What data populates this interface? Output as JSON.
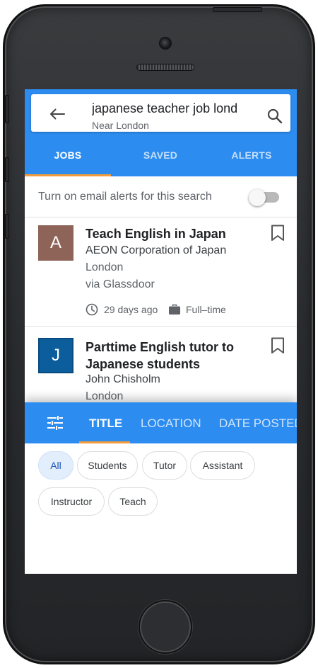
{
  "search": {
    "query": "japanese teacher job lond",
    "location": "Near London"
  },
  "tabs": {
    "jobs": "JOBS",
    "saved": "SAVED",
    "alerts": "ALERTS"
  },
  "alert_row": {
    "text": "Turn on email alerts for this search",
    "toggle_on": false
  },
  "jobs": [
    {
      "logo_letter": "A",
      "logo_color": "#8e6459",
      "title": "Teach English in Japan",
      "company": "AEON Corporation of Japan",
      "location": "London",
      "source": "via Glassdoor",
      "posted": "29 days ago",
      "type": "Full–time"
    },
    {
      "logo_letter": "J",
      "logo_color": "#0b5d9c",
      "title": "Parttime English tutor to Japanese students",
      "company": "John Chisholm",
      "location": "London"
    }
  ],
  "filter": {
    "tabs": [
      "TITLE",
      "LOCATION",
      "DATE POSTED"
    ],
    "active_tab": "TITLE",
    "chips": [
      "All",
      "Students",
      "Tutor",
      "Assistant",
      "Instructor",
      "Teach"
    ],
    "selected_chip": "All"
  },
  "colors": {
    "primary": "#2d8cf0",
    "accent": "#f29b3b"
  },
  "icons": [
    "back-arrow-icon",
    "search-icon",
    "bookmark-icon",
    "clock-icon",
    "briefcase-icon",
    "tune-icon"
  ]
}
